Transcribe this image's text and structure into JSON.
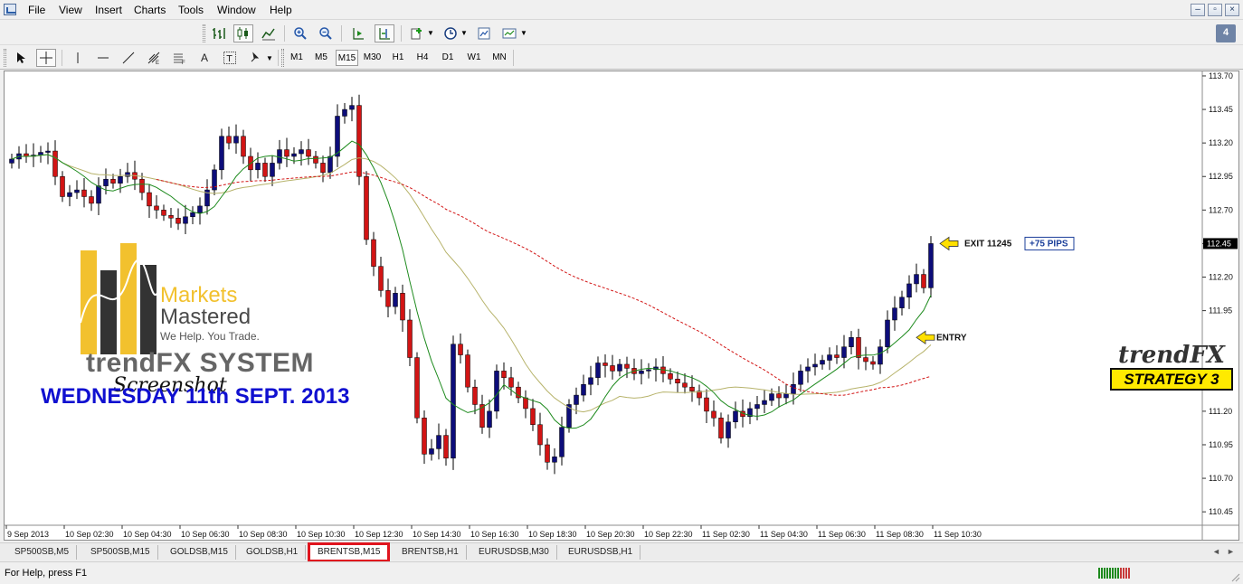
{
  "menu": [
    "File",
    "View",
    "Insert",
    "Charts",
    "Tools",
    "Window",
    "Help"
  ],
  "window_controls": [
    "–",
    "▫",
    "×"
  ],
  "chat_badge": "4",
  "timeframes": [
    {
      "label": "M1",
      "active": false
    },
    {
      "label": "M5",
      "active": false
    },
    {
      "label": "M15",
      "active": true
    },
    {
      "label": "M30",
      "active": false
    },
    {
      "label": "H1",
      "active": false
    },
    {
      "label": "H4",
      "active": false
    },
    {
      "label": "D1",
      "active": false
    },
    {
      "label": "W1",
      "active": false
    },
    {
      "label": "MN",
      "active": false
    }
  ],
  "toolbar_icons": {
    "row1": [
      "bar-chart-icon",
      "candlestick-chart-icon",
      "line-chart-icon",
      "zoom-in-icon",
      "zoom-out-icon",
      "auto-scroll-icon",
      "chart-shift-icon",
      "indicators-icon",
      "periods-icon",
      "templates-icon",
      "chart-properties-icon"
    ],
    "row2": [
      "cursor-icon",
      "crosshair-icon",
      "vertical-line-icon",
      "horizontal-line-icon",
      "trendline-icon",
      "fibonacci-icon",
      "gann-icon",
      "text-icon",
      "text-label-icon",
      "arrows-icon"
    ]
  },
  "chart": {
    "branding": {
      "markets": "Markets",
      "mastered": "Mastered",
      "tagline": "We Help. You Trade.",
      "system": "trendFX SYSTEM",
      "caption": "Screenshot",
      "date_title": "WEDNESDAY 11th SEPT. 2013"
    },
    "strategy": {
      "name": "trendFX",
      "label": "STRATEGY 3"
    },
    "annotations": {
      "exit": "EXIT 11245",
      "pips": "+75 PIPS",
      "entry": "ENTRY"
    },
    "colors": {
      "bull": "#0d0d7a",
      "bear": "#d21414",
      "ma_fast": "#1d8a1d",
      "ma_slow": "#b7b36b",
      "ma_long": "#d21414"
    }
  },
  "chart_data": {
    "type": "candlestick",
    "title": "",
    "xlabel": "",
    "ylabel": "",
    "ylim": [
      110.35,
      113.72
    ],
    "yticks": [
      "113.70",
      "113.45",
      "113.20",
      "112.95",
      "112.70",
      "112.45",
      "112.20",
      "111.95",
      "111.20",
      "110.95",
      "110.70",
      "110.45"
    ],
    "current_price": "112.45",
    "xticks": [
      "9 Sep 2013",
      "10 Sep 02:30",
      "10 Sep 04:30",
      "10 Sep 06:30",
      "10 Sep 08:30",
      "10 Sep 10:30",
      "10 Sep 12:30",
      "10 Sep 14:30",
      "10 Sep 16:30",
      "10 Sep 18:30",
      "10 Sep 20:30",
      "10 Sep 22:30",
      "11 Sep 02:30",
      "11 Sep 04:30",
      "11 Sep 06:30",
      "11 Sep 08:30",
      "11 Sep 10:30"
    ],
    "close": [
      113.08,
      113.12,
      113.1,
      113.11,
      113.13,
      113.14,
      112.95,
      112.8,
      112.83,
      112.85,
      112.8,
      112.75,
      112.88,
      112.93,
      112.9,
      112.95,
      112.98,
      112.93,
      112.83,
      112.73,
      112.7,
      112.66,
      112.64,
      112.6,
      112.65,
      112.68,
      112.73,
      112.85,
      113.0,
      113.25,
      113.2,
      113.25,
      113.1,
      113.0,
      113.05,
      112.95,
      113.05,
      113.15,
      113.1,
      113.12,
      113.15,
      113.1,
      113.05,
      112.98,
      113.1,
      113.4,
      113.45,
      113.48,
      112.95,
      112.48,
      112.28,
      112.1,
      111.98,
      112.08,
      111.88,
      111.6,
      111.15,
      110.88,
      110.92,
      111.02,
      110.85,
      111.7,
      111.62,
      111.38,
      111.25,
      111.08,
      111.2,
      111.5,
      111.45,
      111.38,
      111.3,
      111.22,
      111.1,
      110.95,
      110.82,
      110.86,
      111.08,
      111.25,
      111.32,
      111.4,
      111.45,
      111.56,
      111.54,
      111.5,
      111.55,
      111.52,
      111.48,
      111.5,
      111.51,
      111.53,
      111.48,
      111.44,
      111.41,
      111.38,
      111.35,
      111.3,
      111.2,
      111.15,
      111.0,
      111.12,
      111.2,
      111.16,
      111.22,
      111.25,
      111.28,
      111.33,
      111.3,
      111.33,
      111.4,
      111.5,
      111.53,
      111.55,
      111.58,
      111.62,
      111.6,
      111.68,
      111.75,
      111.6,
      111.57,
      111.55,
      111.68,
      111.88,
      111.97,
      112.05,
      112.15,
      112.22,
      112.12,
      112.45
    ]
  }
}
